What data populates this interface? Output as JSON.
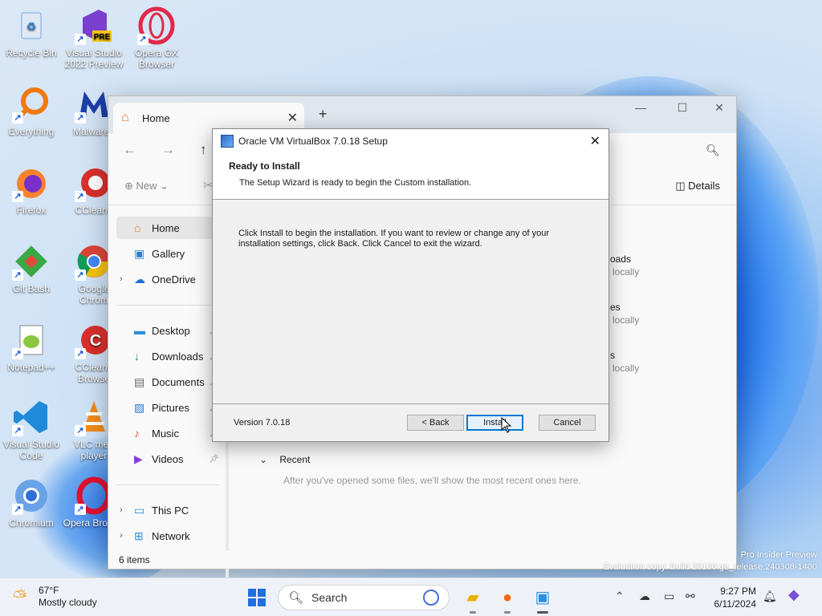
{
  "desktop": {
    "icons": [
      {
        "label": "Recycle Bin"
      },
      {
        "label": "Visual Studio 2022 Preview",
        "badge": "PRE"
      },
      {
        "label": "Opera GX Browser"
      },
      {
        "label": "Everything"
      },
      {
        "label": "Malwareb"
      },
      {
        "label": "Firefox"
      },
      {
        "label": "CCleane"
      },
      {
        "label": "Git Bash"
      },
      {
        "label": "Google Chrom"
      },
      {
        "label": "Notepad++"
      },
      {
        "label": "CCleane Browse"
      },
      {
        "label": "Visual Studio Code"
      },
      {
        "label": "VLC med player"
      },
      {
        "label": "Chromium"
      },
      {
        "label": "Opera Browse"
      }
    ]
  },
  "explorer": {
    "tab_title": "Home",
    "toolbar": {
      "new_label": "New",
      "details_label": "Details"
    },
    "sidebar": {
      "home": "Home",
      "gallery": "Gallery",
      "onedrive": "OneDrive",
      "desktop": "Desktop",
      "downloads": "Downloads",
      "documents": "Documents",
      "pictures": "Pictures",
      "music": "Music",
      "videos": "Videos",
      "thispc": "This PC",
      "network": "Network"
    },
    "peek": {
      "a1": "oads",
      "a2": "locally",
      "b1": "es",
      "b2": "locally",
      "c1": "s",
      "c2": "locally"
    },
    "recent_title": "Recent",
    "recent_empty": "After you've opened some files, we'll show the most recent ones here.",
    "status": "6 items"
  },
  "dialog": {
    "title": "Oracle VM VirtualBox 7.0.18 Setup",
    "heading": "Ready to Install",
    "subheading": "The Setup Wizard is ready to begin the Custom installation.",
    "body_line1": "Click Install to begin the installation. If you want to review or change any of your",
    "body_line2": "installation settings, click Back. Click Cancel to exit the wizard.",
    "version": "Version 7.0.18",
    "back_label": "< Back",
    "install_label": "Install",
    "cancel_label": "Cancel"
  },
  "watermark": {
    "line1": "Pro Insider Preview",
    "line2": "Evaluation copy. Build 26100.ge_release.240308-1400"
  },
  "taskbar": {
    "temperature": "67°F",
    "condition": "Mostly cloudy",
    "search_placeholder": "Search",
    "time": "9:27 PM",
    "date": "6/11/2024"
  },
  "colors": {
    "accent": "#0078d7",
    "explorer_bg": "#f9f9f9",
    "dialog_bg": "#f0f0f0"
  }
}
